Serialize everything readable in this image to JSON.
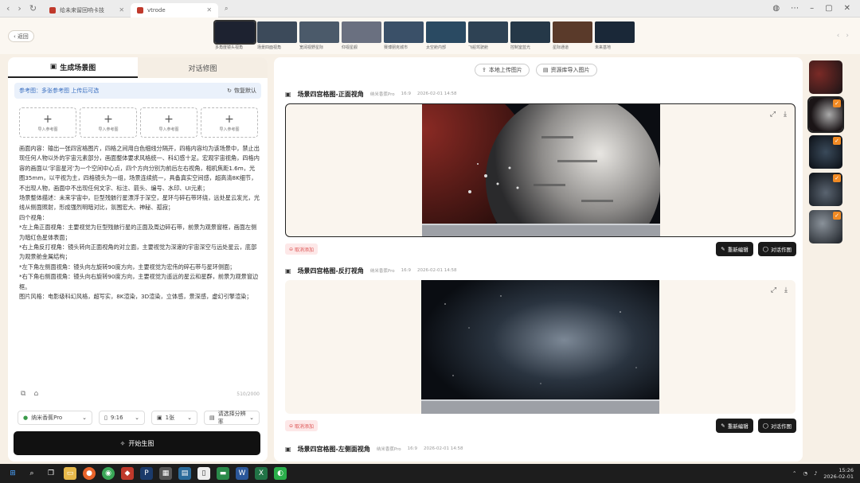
{
  "browser": {
    "tabs": [
      {
        "label": "给未来留回响卡技"
      },
      {
        "label": "vtrode"
      }
    ]
  },
  "nav": {
    "back_label": "返回"
  },
  "thumbnails": [
    {
      "caption": "多角度镜头视角",
      "color": "#1d2230"
    },
    {
      "caption": "场景四面视角",
      "color": "#3c4a5a"
    },
    {
      "caption": "宽阔视野星际",
      "color": "#4b5a6a"
    },
    {
      "caption": "仰视星舰",
      "color": "#6a7080"
    },
    {
      "caption": "赛博朋克城市",
      "color": "#3a5068"
    },
    {
      "caption": "太空舱内部",
      "color": "#2a4a62"
    },
    {
      "caption": "飞船驾驶舱",
      "color": "#2e4254"
    },
    {
      "caption": "控制室蓝光",
      "color": "#253848"
    },
    {
      "caption": "星际通道",
      "color": "#5a3a2a"
    },
    {
      "caption": "未来基地",
      "color": "#1a2838"
    }
  ],
  "left": {
    "tabs": [
      "生成场景图",
      "对话修图"
    ],
    "ref_hint": "参考图：多张参考图 上传后可选",
    "reset_label": "恢复默认",
    "uploads": [
      "导入参考图",
      "导入参考图",
      "导入参考图",
      "导入参考图"
    ],
    "prompt": "画面内容：输出一张四宫格图片，四格之间用白色细线分隔开，四格内容均为该场景中，禁止出现任何人物以外的宇宙元素部分，画面整体要求风格统一、科幻感十足。宏观宇宙视角，四格内容的画面以‘宇宙星河’为一个空间中心点，四个方向分别为前后左右视角，相机焦距1.6m，光圈35mm，以平视为主，四格镜头为一组，场景连续统一，具备真实空间感，超高清8K细节，不出现人物，画面中不出现任何文字、标注、箭头、编号、水印、UI元素；\n场景整体描述：未来宇宙中，巨型残骸行星漂浮于深空，星环与碎石带环绕，远处星云发光，光线从侧面照射，形成强烈明暗对比，氛围宏大、神秘、孤寂；\n四个视角：\n*左上角正面视角：主要视觉为巨型残骸行星的正面及周边碎石带，前景为观景窗框，画面左侧为暗红色星体表面；\n*右上角反打视角：镜头转向正面视角的对立面，主要视觉为深邃的宇宙深空与远处星云，底部为观景舱金属结构；\n*左下角左侧面视角：镜头向左旋转90度方向，主要视觉为宏伟的碎石带与星环侧面；\n*右下角右侧面视角：镜头向右旋转90度方向，主要视觉为遥远的星云和星群，前景为观景窗边框。\n图片风格：电影级科幻风格，超写实，8K渲染，3D渲染，立体感，景深感，虚幻引擎渲染；",
    "char_count": "510/2000",
    "settings": {
      "model": "纳米香蕉Pro",
      "ratio": "9:16",
      "count": "1张",
      "quality": "请选择分辨率"
    },
    "generate_label": "开始生图"
  },
  "center": {
    "upload_local": "本地上传图片",
    "upload_library": "资源库导入图片",
    "results": [
      {
        "title": "场景四宫格图-正面视角",
        "model": "纳米香蕉Pro",
        "ratio": "16:9",
        "time": "2026-02-01 14:58",
        "cancel": "取消添加",
        "btn_regen": "重新编辑",
        "btn_dialog": "对话作图"
      },
      {
        "title": "场景四宫格图-反打视角",
        "model": "纳米香蕉Pro",
        "ratio": "16:9",
        "time": "2026-02-01 14:58",
        "cancel": "取消添加",
        "btn_regen": "重新编辑",
        "btn_dialog": "对话作图"
      },
      {
        "title": "场景四宫格图-左侧面视角",
        "model": "纳米香蕉Pro",
        "ratio": "16:9",
        "time": "2026-02-01 14:58"
      }
    ]
  },
  "taskbar": {
    "time": "15:26",
    "date": "2026-02-01"
  }
}
